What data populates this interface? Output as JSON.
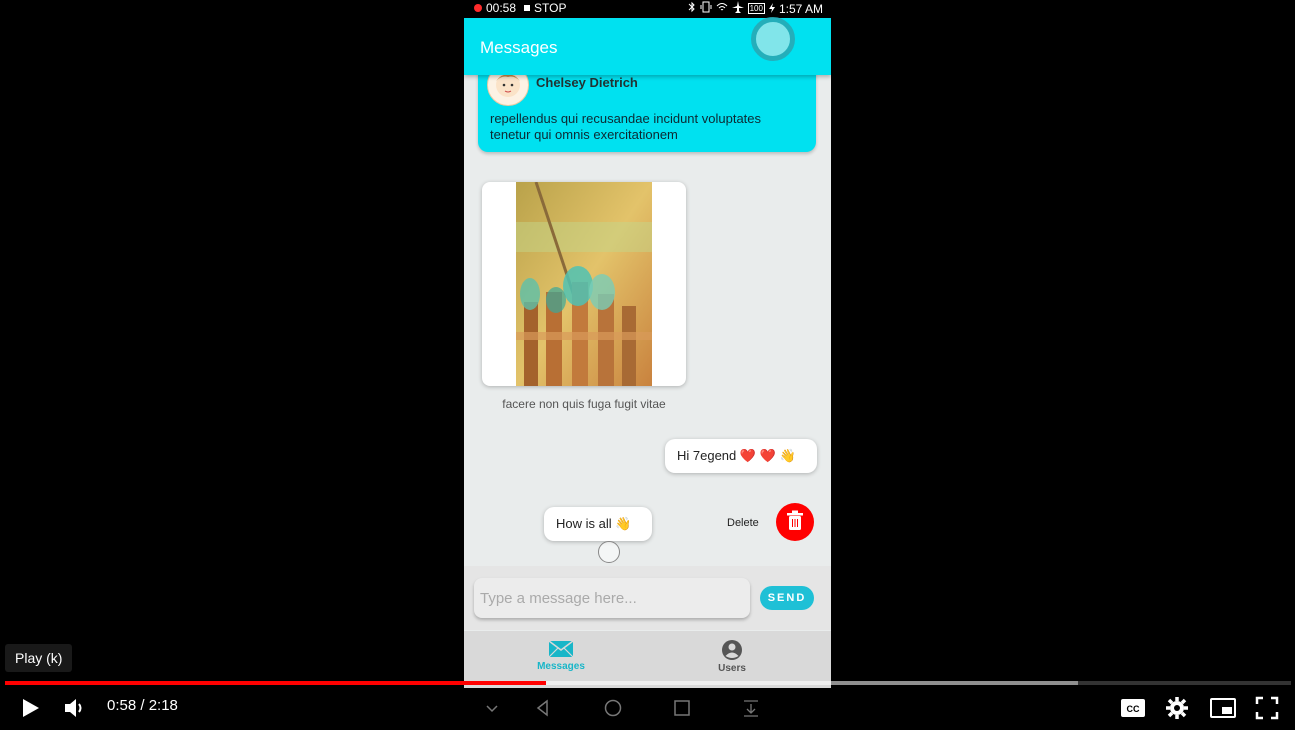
{
  "statusbar": {
    "rec_time": "00:58",
    "stop_label": "STOP",
    "battery": "100",
    "clock": "1:57 AM"
  },
  "app": {
    "title": "Messages"
  },
  "messages": {
    "card": {
      "sender": "Chelsey Dietrich",
      "text": "repellendus qui recusandae incidunt voluptates tenetur qui omnis exercitationem"
    },
    "image_caption": "facere non quis fuga fugit vitae",
    "bubble1": "Hi 7egend ❤️ ❤️ 👋",
    "bubble2": "How is all 👋",
    "delete_label": "Delete"
  },
  "composer": {
    "placeholder": "Type a message here...",
    "send_label": "SEND"
  },
  "bottom_nav": {
    "messages_label": "Messages",
    "users_label": "Users"
  },
  "player": {
    "tooltip": "Play (k)",
    "time": "0:58 / 2:18",
    "played_fraction": 0.4204,
    "buffered_fraction": 0.8341
  },
  "colors": {
    "accent": "#00e1f0",
    "progress": "#ff0000",
    "delete": "#ff0000"
  }
}
